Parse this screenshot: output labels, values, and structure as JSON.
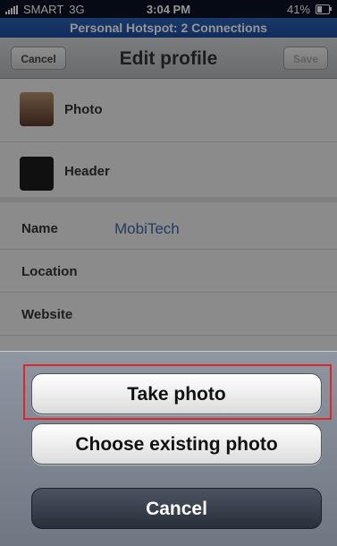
{
  "status_bar": {
    "carrier": "SMART",
    "network": "3G",
    "time": "3:04 PM",
    "battery": "41%",
    "battery_level": 0.41
  },
  "hotspot": {
    "text": "Personal Hotspot: 2 Connections"
  },
  "nav": {
    "title": "Edit profile",
    "cancel_label": "Cancel",
    "save_label": "Save"
  },
  "profile": {
    "photo_label": "Photo",
    "header_label": "Header",
    "name_label": "Name",
    "name_value": "MobiTech",
    "location_label": "Location",
    "website_label": "Website"
  },
  "action_sheet": {
    "take_photo": "Take photo",
    "choose_existing": "Choose existing photo",
    "cancel": "Cancel"
  },
  "colors": {
    "hotspot_bar": "#2a62b5",
    "highlight": "#e0262a",
    "name_value": "#3e6aa8"
  }
}
